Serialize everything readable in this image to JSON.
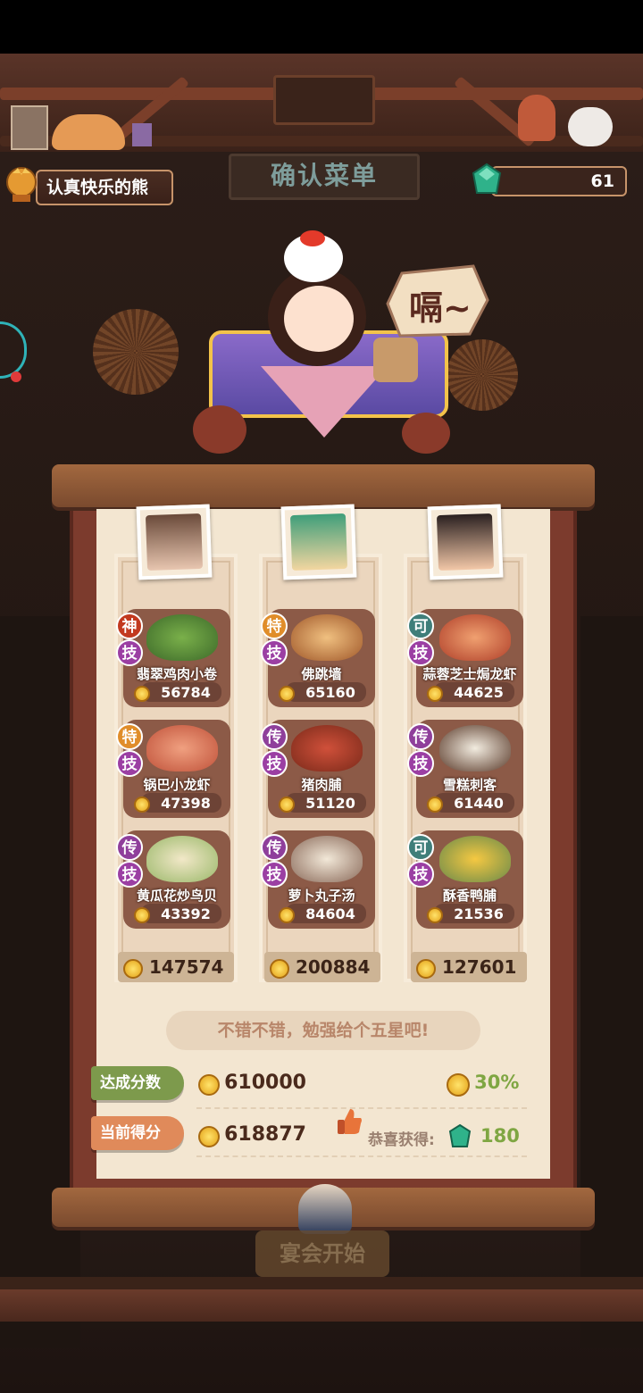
{
  "header": {
    "player_name": "认真快乐的熊",
    "gem_count": "61",
    "sign_text": "确认菜单",
    "speech_bubble": "嗝~"
  },
  "columns": [
    {
      "dishes": [
        {
          "badge": "神",
          "badge_color": "#c2391f",
          "skill": "技",
          "name": "翡翠鸡肉小卷",
          "score": "56784"
        },
        {
          "badge": "特",
          "badge_color": "#e08d2a",
          "skill": "技",
          "name": "锅巴小龙虾",
          "score": "47398"
        },
        {
          "badge": "传",
          "badge_color": "#8f3f9b",
          "skill": "技",
          "name": "黄瓜花炒鸟贝",
          "score": "43392"
        }
      ],
      "total": "147574"
    },
    {
      "dishes": [
        {
          "badge": "特",
          "badge_color": "#e08d2a",
          "skill": "技",
          "name": "佛跳墙",
          "score": "65160"
        },
        {
          "badge": "传",
          "badge_color": "#8f3f9b",
          "skill": "技",
          "name": "猪肉脯",
          "score": "51120"
        },
        {
          "badge": "传",
          "badge_color": "#8f3f9b",
          "skill": "技",
          "name": "萝卜丸子汤",
          "score": "84604"
        }
      ],
      "total": "200884"
    },
    {
      "dishes": [
        {
          "badge": "可",
          "badge_color": "#3f7e7a",
          "skill": "技",
          "name": "蒜蓉芝士焗龙虾",
          "score": "44625"
        },
        {
          "badge": "传",
          "badge_color": "#8f3f9b",
          "skill": "技",
          "name": "雪糕刺客",
          "score": "61440"
        },
        {
          "badge": "可",
          "badge_color": "#3f7e7a",
          "skill": "技",
          "name": "酥香鸭脯",
          "score": "21536"
        }
      ],
      "total": "127601"
    }
  ],
  "comment": "不错不错，勉强给个五星吧!",
  "results": {
    "target_label": "达成分数",
    "target_score": "610000",
    "bonus_percent": "30%",
    "current_label": "当前得分",
    "current_score": "618877",
    "reward_label": "恭喜获得:",
    "reward_gems": "180"
  },
  "start_button": "宴会开始"
}
